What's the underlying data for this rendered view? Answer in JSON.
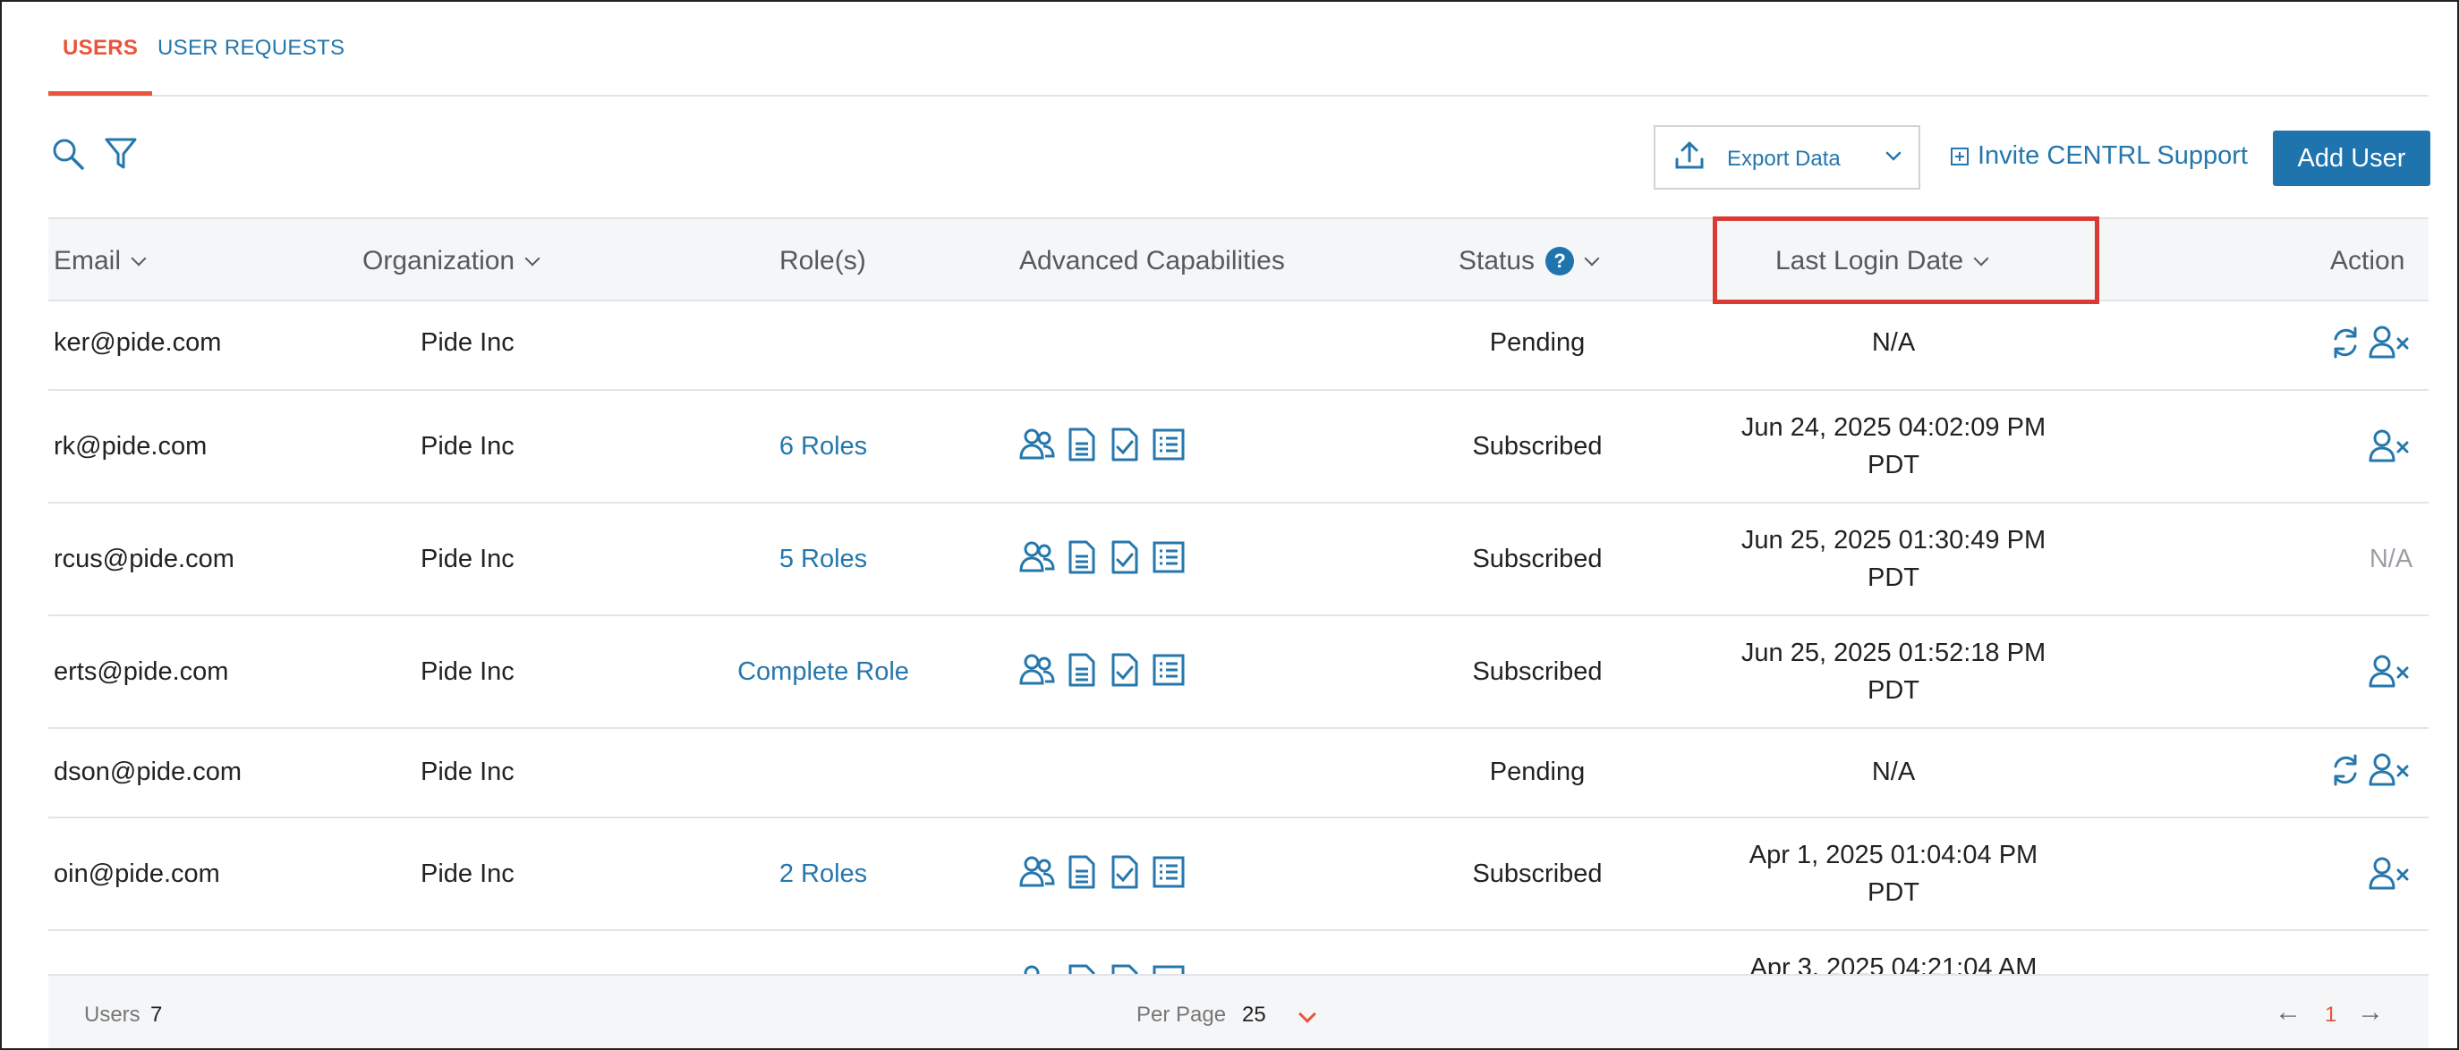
{
  "tabs": {
    "users": "USERS",
    "user_requests": "USER REQUESTS"
  },
  "toolbar": {
    "export_label": "Export Data",
    "invite_label": "Invite CENTRL Support",
    "add_user_label": "Add User"
  },
  "table": {
    "headers": {
      "email": "Email",
      "organization": "Organization",
      "roles": "Role(s)",
      "advanced": "Advanced Capabilities",
      "status": "Status",
      "status_help": "?",
      "last_login": "Last Login Date",
      "action": "Action"
    },
    "rows": [
      {
        "email": "ker@pide.com",
        "org": "Pide Inc",
        "roles": "",
        "status": "Pending",
        "login_line1": "N/A",
        "login_line2": "",
        "action_text": ""
      },
      {
        "email": "rk@pide.com",
        "org": "Pide Inc",
        "roles": "6 Roles",
        "status": "Subscribed",
        "login_line1": "Jun 24, 2025 04:02:09 PM",
        "login_line2": "PDT",
        "action_text": ""
      },
      {
        "email": "rcus@pide.com",
        "org": "Pide Inc",
        "roles": "5 Roles",
        "status": "Subscribed",
        "login_line1": "Jun 25, 2025 01:30:49 PM",
        "login_line2": "PDT",
        "action_text": "N/A"
      },
      {
        "email": "erts@pide.com",
        "org": "Pide Inc",
        "roles": "Complete Role",
        "status": "Subscribed",
        "login_line1": "Jun 25, 2025 01:52:18 PM",
        "login_line2": "PDT",
        "action_text": ""
      },
      {
        "email": "dson@pide.com",
        "org": "Pide Inc",
        "roles": "",
        "status": "Pending",
        "login_line1": "N/A",
        "login_line2": "",
        "action_text": ""
      },
      {
        "email": "oin@pide.com",
        "org": "Pide Inc",
        "roles": "2 Roles",
        "status": "Subscribed",
        "login_line1": "Apr 1, 2025 01:04:04 PM",
        "login_line2": "PDT",
        "action_text": ""
      },
      {
        "email": "",
        "org": "",
        "roles": "",
        "status": "",
        "login_line1": "Apr 3, 2025 04:21:04 AM",
        "login_line2": "",
        "action_text": ""
      }
    ]
  },
  "footer": {
    "users_label": "Users",
    "users_count": "7",
    "per_page_label": "Per Page",
    "per_page_value": "25",
    "prev": "←",
    "current_page": "1",
    "next": "→"
  },
  "colors": {
    "accent": "#e8553a",
    "link": "#2577ad",
    "primary_button": "#1f74ae",
    "highlight_box": "#d93a32"
  }
}
